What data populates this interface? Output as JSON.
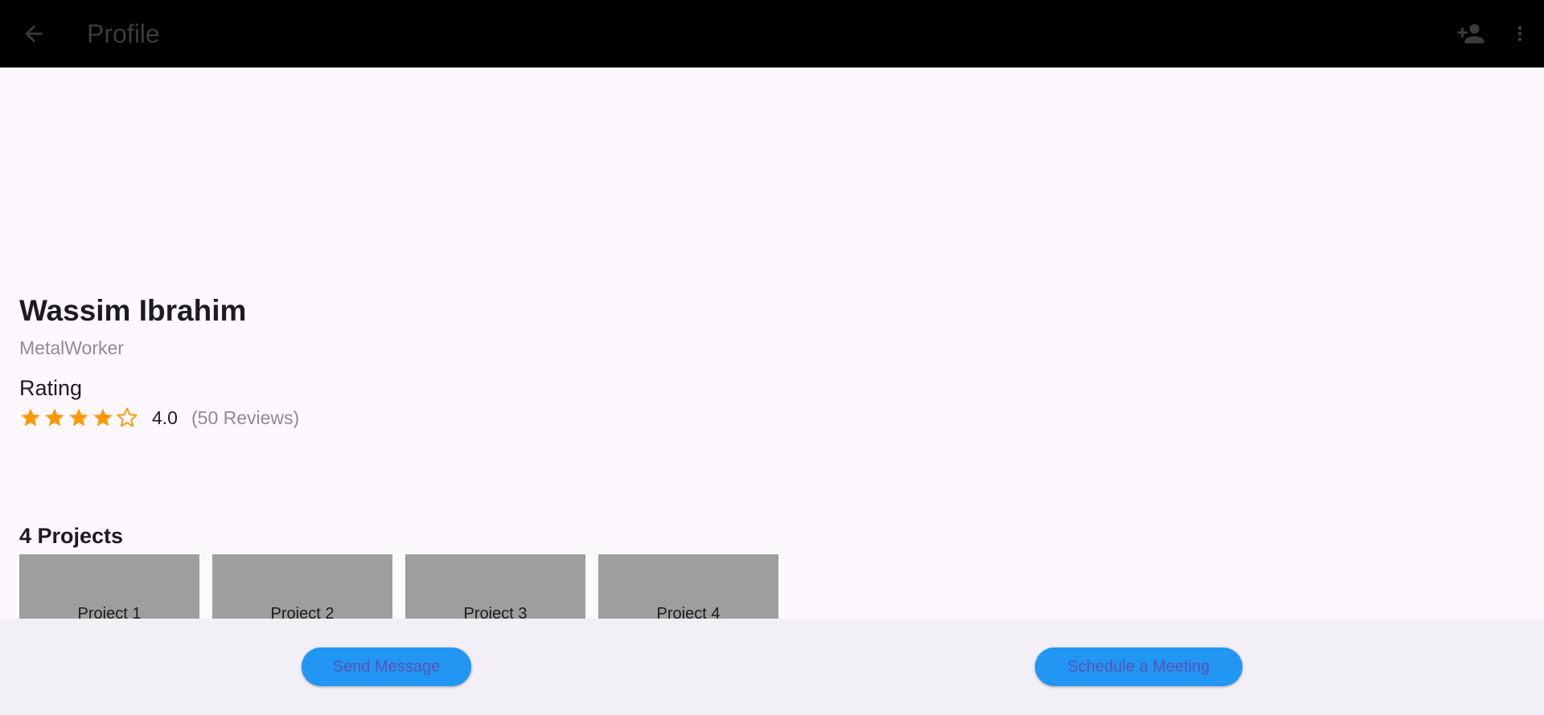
{
  "appbar": {
    "title": "Profile",
    "back_icon": "arrow-back-icon",
    "add_person_icon": "person-add-icon",
    "more_icon": "more-vert-icon"
  },
  "profile": {
    "name": "Wassim Ibrahim",
    "profession": "MetalWorker"
  },
  "rating": {
    "heading": "Rating",
    "stars_filled": 4,
    "stars_total": 5,
    "value": "4.0",
    "reviews": "(50 Reviews)"
  },
  "projects": {
    "heading": "4 Projects",
    "items": [
      {
        "label": "Project 1"
      },
      {
        "label": "Project 2"
      },
      {
        "label": "Project 3"
      },
      {
        "label": "Project 4"
      }
    ]
  },
  "actions": {
    "send_message": "Send Message",
    "schedule_meeting": "Schedule a Meeting"
  },
  "colors": {
    "appbar_bg": "#000000",
    "page_bg": "#fdf7fe",
    "bottom_bar_bg": "#f3eff6",
    "star": "#ff9800",
    "button_bg": "#2196f3",
    "button_text": "#5a52b5",
    "project_card": "#9e9e9e"
  }
}
